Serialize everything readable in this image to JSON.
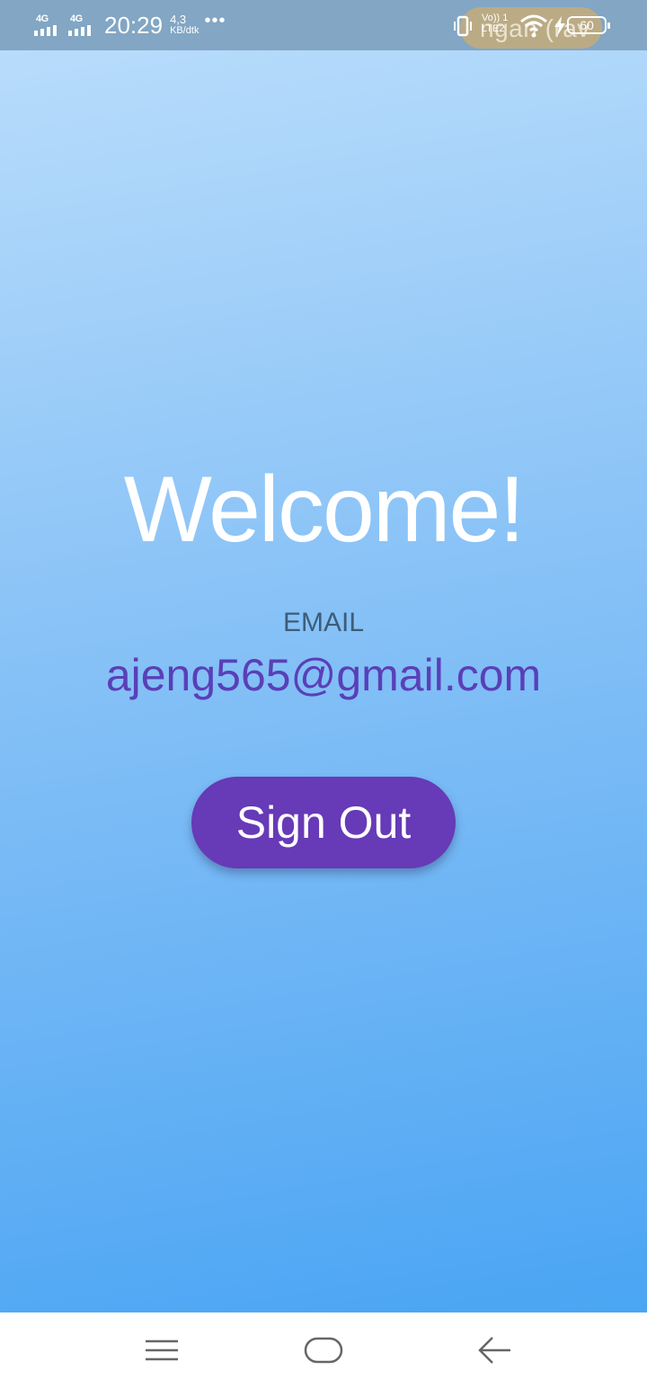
{
  "status_bar": {
    "sim1_label": "4G",
    "sim2_label": "4G",
    "time": "20:29",
    "net_speed_value": "4,3",
    "net_speed_unit": "KB/dtk",
    "more_indicator": "•••",
    "volte_label": "Vo)) 1",
    "lte_label": "LTE2",
    "ticker_text": "ngan (rav",
    "battery_level": "60",
    "icons": [
      "vibrate-icon",
      "wifi-icon",
      "charging-icon",
      "battery-icon"
    ]
  },
  "main": {
    "title": "Welcome!",
    "email_label": "EMAIL",
    "email_value": "ajeng565@gmail.com",
    "sign_out_label": "Sign Out"
  },
  "navbar": {
    "icons": [
      "menu-icon",
      "home-icon",
      "back-icon"
    ]
  },
  "colors": {
    "status_bar_bg": "#82a6c3",
    "gradient_top": "#b8dcfb",
    "gradient_bottom": "#4aa5f3",
    "button_bg": "#673ab7",
    "email_text": "#5a3fb8",
    "email_label": "#3d5c78"
  }
}
